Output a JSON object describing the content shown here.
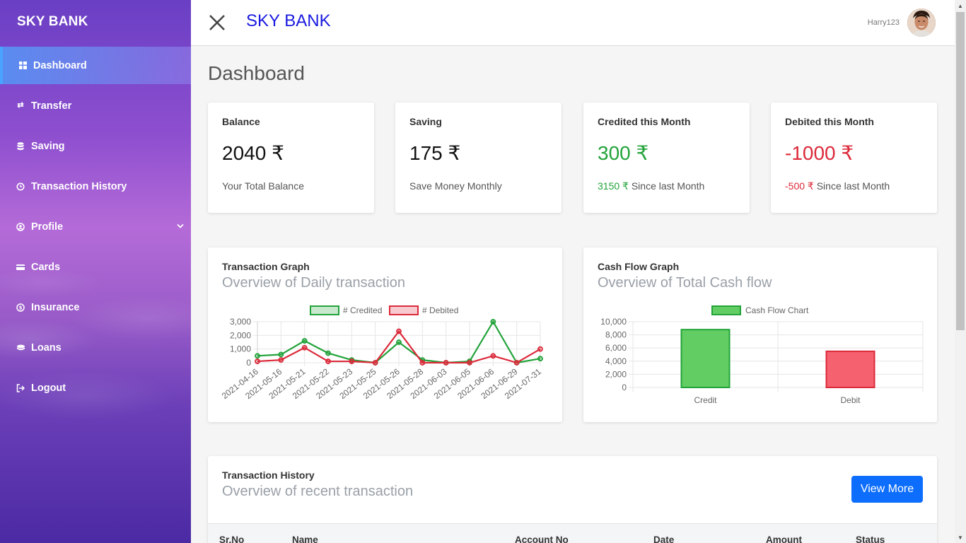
{
  "sidebar": {
    "brand": "SKY BANK",
    "items": [
      {
        "label": "Dashboard",
        "icon": "grid-icon"
      },
      {
        "label": "Transfer",
        "icon": "transfer-icon"
      },
      {
        "label": "Saving",
        "icon": "database-icon"
      },
      {
        "label": "Transaction History",
        "icon": "history-icon"
      },
      {
        "label": "Profile",
        "icon": "user-circle-icon"
      },
      {
        "label": "Cards",
        "icon": "credit-card-icon"
      },
      {
        "label": "Insurance",
        "icon": "rupee-circle-icon"
      },
      {
        "label": "Loans",
        "icon": "coins-icon"
      },
      {
        "label": "Logout",
        "icon": "logout-icon"
      }
    ],
    "active_index": 0
  },
  "topbar": {
    "title": "SKY BANK",
    "username": "Harry123"
  },
  "page": {
    "title": "Dashboard"
  },
  "stats": [
    {
      "title": "Balance",
      "value": "2040 ₹",
      "sub_text": "Your Total Balance"
    },
    {
      "title": "Saving",
      "value": "175 ₹",
      "sub_text": "Save Money Monthly"
    },
    {
      "title": "Credited this Month",
      "value": "300 ₹",
      "sub_highlight": "3150 ₹",
      "sub_text": " Since last Month"
    },
    {
      "title": "Debited this Month",
      "value": "-1000 ₹",
      "sub_highlight": "-500 ₹",
      "sub_text": " Since last Month"
    }
  ],
  "colors": {
    "credit": "#22a33a",
    "debit": "#dc2a3a",
    "primary": "#0d6efd",
    "brand_title": "#1a1ae0"
  },
  "transaction_graph": {
    "title": "Transaction Graph",
    "subtitle": "Overview of Daily transaction"
  },
  "cashflow_graph": {
    "title": "Cash Flow Graph",
    "subtitle": "Overview of Total Cash flow"
  },
  "chart_data": [
    {
      "type": "line",
      "x": [
        "2021-04-16",
        "2021-05-16",
        "2021-05-21",
        "2021-05-22",
        "2021-05-23",
        "2021-05-25",
        "2021-05-26",
        "2021-05-28",
        "2021-06-03",
        "2021-06-05",
        "2021-06-06",
        "2021-06-29",
        "2021-07-31"
      ],
      "series": [
        {
          "name": "# Credited",
          "color": "#22a33a",
          "values": [
            500,
            600,
            1600,
            700,
            200,
            0,
            1500,
            200,
            0,
            100,
            3000,
            0,
            300
          ]
        },
        {
          "name": "# Debited",
          "color": "#dc2a3a",
          "values": [
            100,
            200,
            1100,
            100,
            100,
            0,
            2300,
            0,
            0,
            0,
            500,
            0,
            1000
          ]
        }
      ],
      "yticks": [
        "3,000",
        "2,000",
        "1,000",
        "0"
      ],
      "ylim": [
        0,
        3000
      ],
      "grid": true,
      "legend": "top"
    },
    {
      "type": "bar",
      "categories": [
        "Credit",
        "Debit"
      ],
      "series": [
        {
          "name": "Cash Flow Chart",
          "values": [
            8800,
            5500
          ]
        }
      ],
      "colors": [
        "#62cd62",
        "#f5616e"
      ],
      "yticks": [
        "10,000",
        "8,000",
        "6,000",
        "4,000",
        "2,000",
        "0"
      ],
      "ylim": [
        0,
        10000
      ],
      "grid": true,
      "legend": "top"
    }
  ],
  "history": {
    "title": "Transaction History",
    "subtitle": "Overview of recent transaction",
    "view_more": "View More",
    "columns": [
      "Sr.No",
      "Name",
      "Account No",
      "Date",
      "Amount",
      "Status"
    ]
  }
}
